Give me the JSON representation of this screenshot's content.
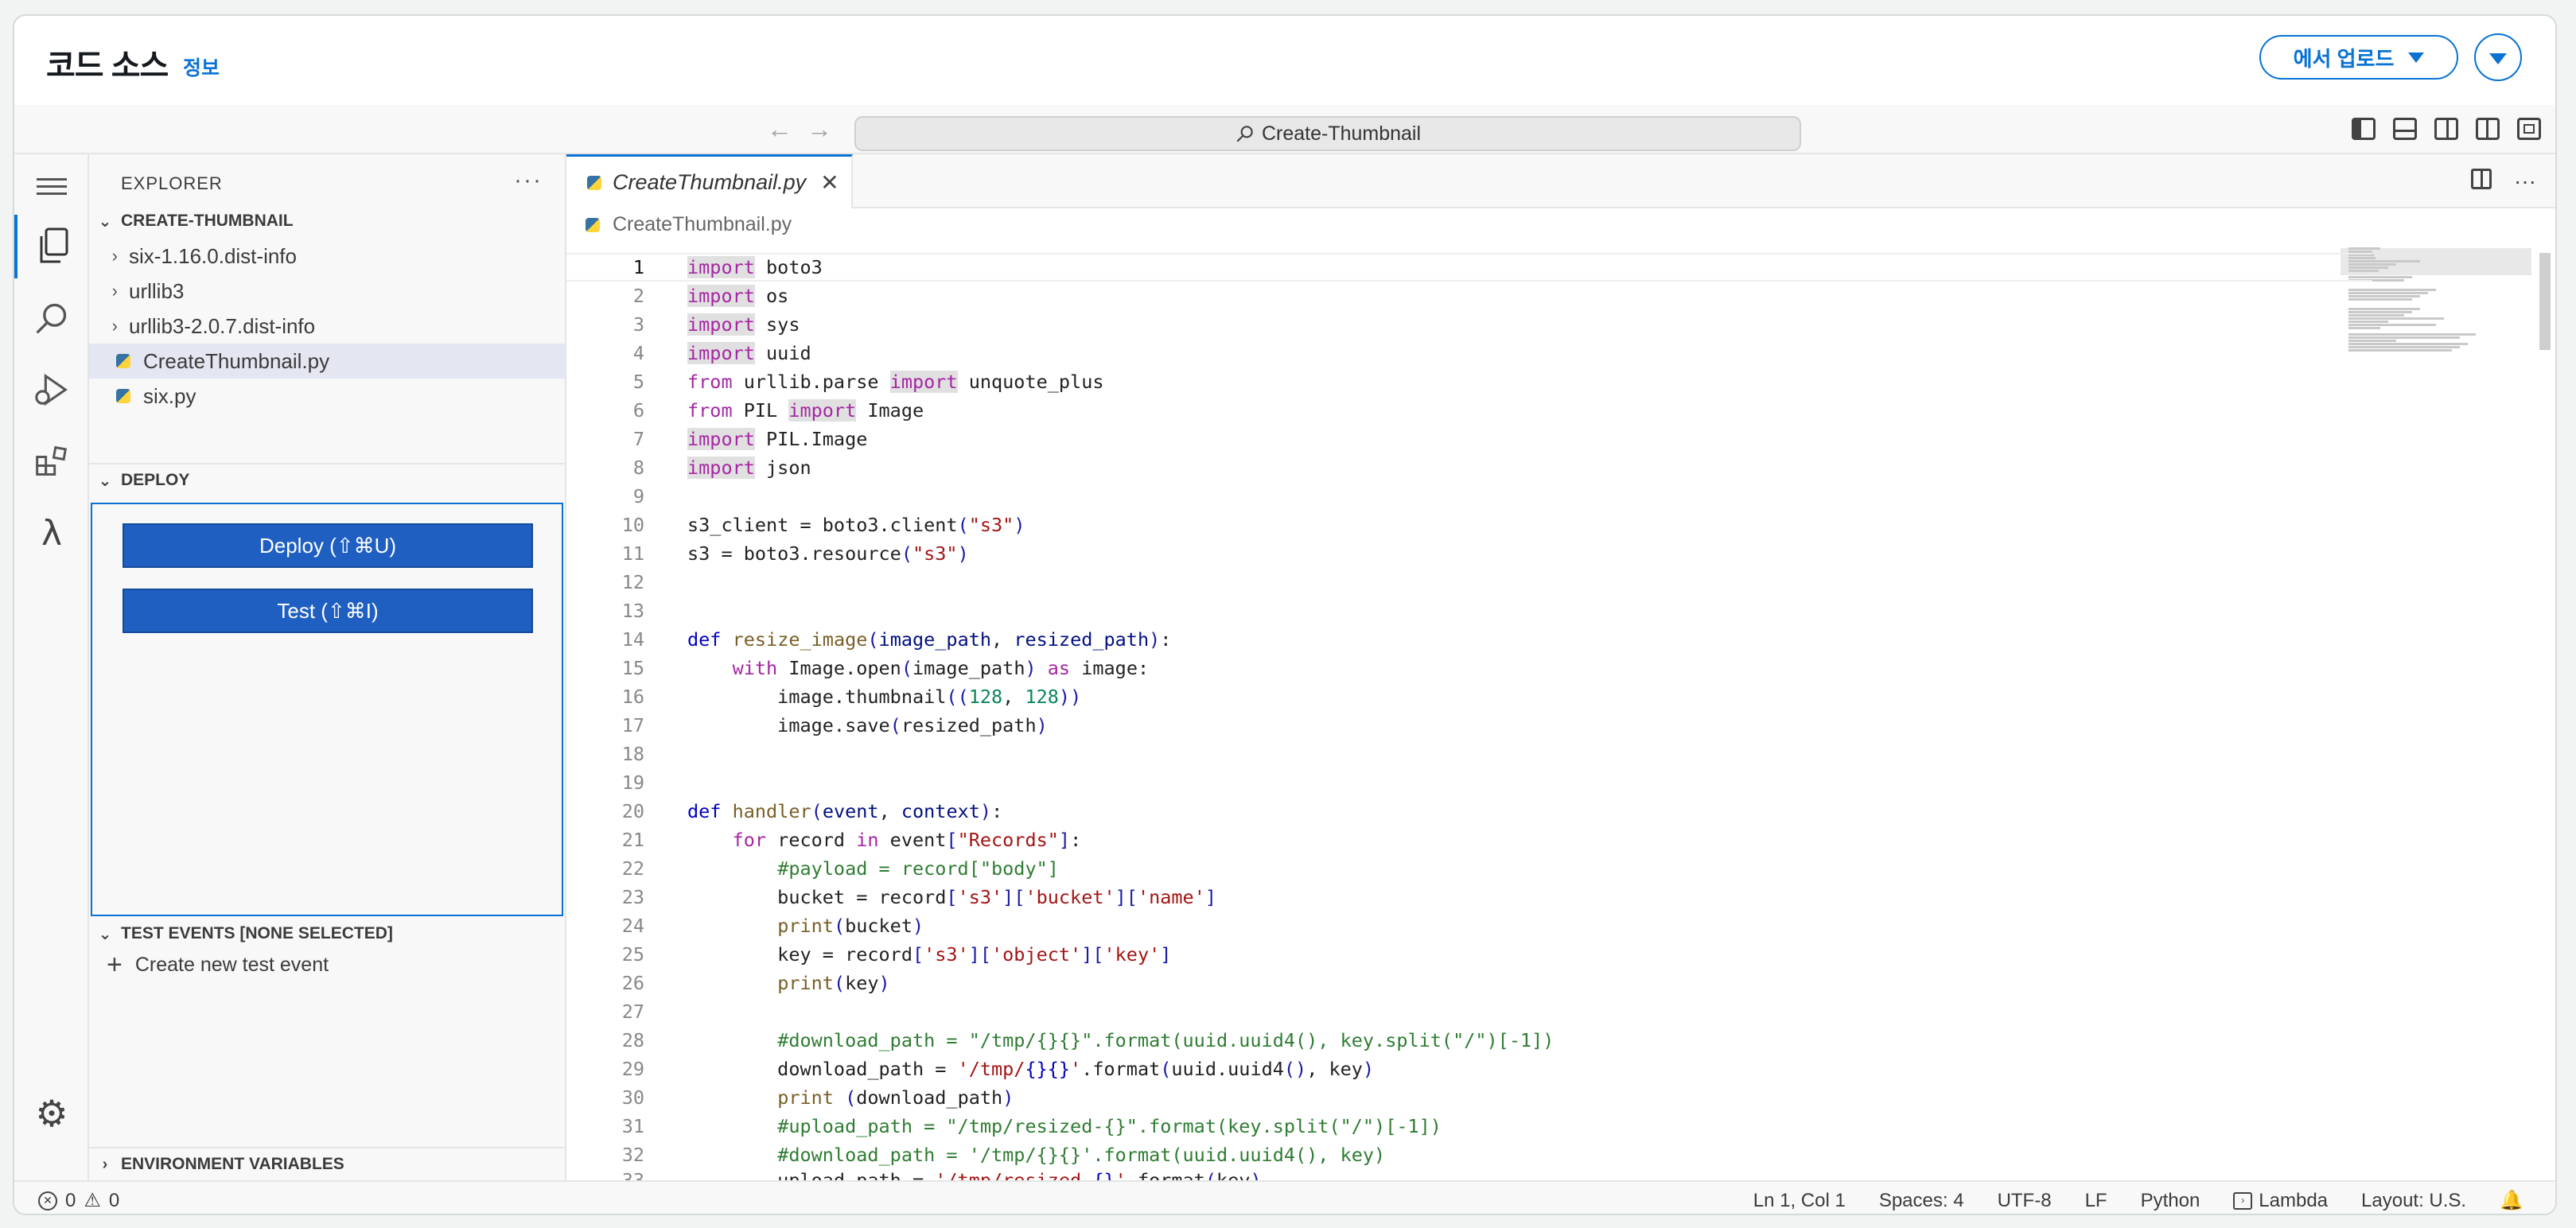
{
  "console": {
    "title": "코드 소스",
    "info_link": "정보",
    "upload_button": "에서 업로드"
  },
  "titlebar": {
    "search_text": "Create-Thumbnail"
  },
  "explorer": {
    "title": "EXPLORER",
    "project_section": "CREATE-THUMBNAIL",
    "items": [
      {
        "label": "six-1.16.0.dist-info",
        "type": "folder"
      },
      {
        "label": "urllib3",
        "type": "folder"
      },
      {
        "label": "urllib3-2.0.7.dist-info",
        "type": "folder"
      },
      {
        "label": "CreateThumbnail.py",
        "type": "python",
        "selected": true
      },
      {
        "label": "six.py",
        "type": "python"
      }
    ]
  },
  "deploy": {
    "section": "DEPLOY",
    "deploy_button": "Deploy (⇧⌘U)",
    "test_button": "Test (⇧⌘I)"
  },
  "test_events": {
    "section": "TEST EVENTS [NONE SELECTED]",
    "create_label": "Create new test event"
  },
  "env_vars": {
    "section": "ENVIRONMENT VARIABLES"
  },
  "editor": {
    "tab_label": "CreateThumbnail.py",
    "breadcrumb": "CreateThumbnail.py",
    "current_line": 1,
    "line_numbers": [
      "1",
      "2",
      "3",
      "4",
      "5",
      "6",
      "7",
      "8",
      "9",
      "10",
      "11",
      "12",
      "13",
      "14",
      "15",
      "16",
      "17",
      "18",
      "19",
      "20",
      "21",
      "22",
      "23",
      "24",
      "25",
      "26",
      "27",
      "28",
      "29",
      "30",
      "31",
      "32",
      "33"
    ]
  },
  "status": {
    "errors": "0",
    "warnings": "0",
    "cursor": "Ln 1, Col 1",
    "spaces": "Spaces: 4",
    "encoding": "UTF-8",
    "eol": "LF",
    "language": "Python",
    "runtime": "Lambda",
    "layout": "Layout: U.S."
  },
  "colors": {
    "accent": "#0972d3",
    "button_bg": "#1f5fc1",
    "keyword": "#a626a4",
    "string": "#a31515",
    "comment": "#2e7d32"
  }
}
